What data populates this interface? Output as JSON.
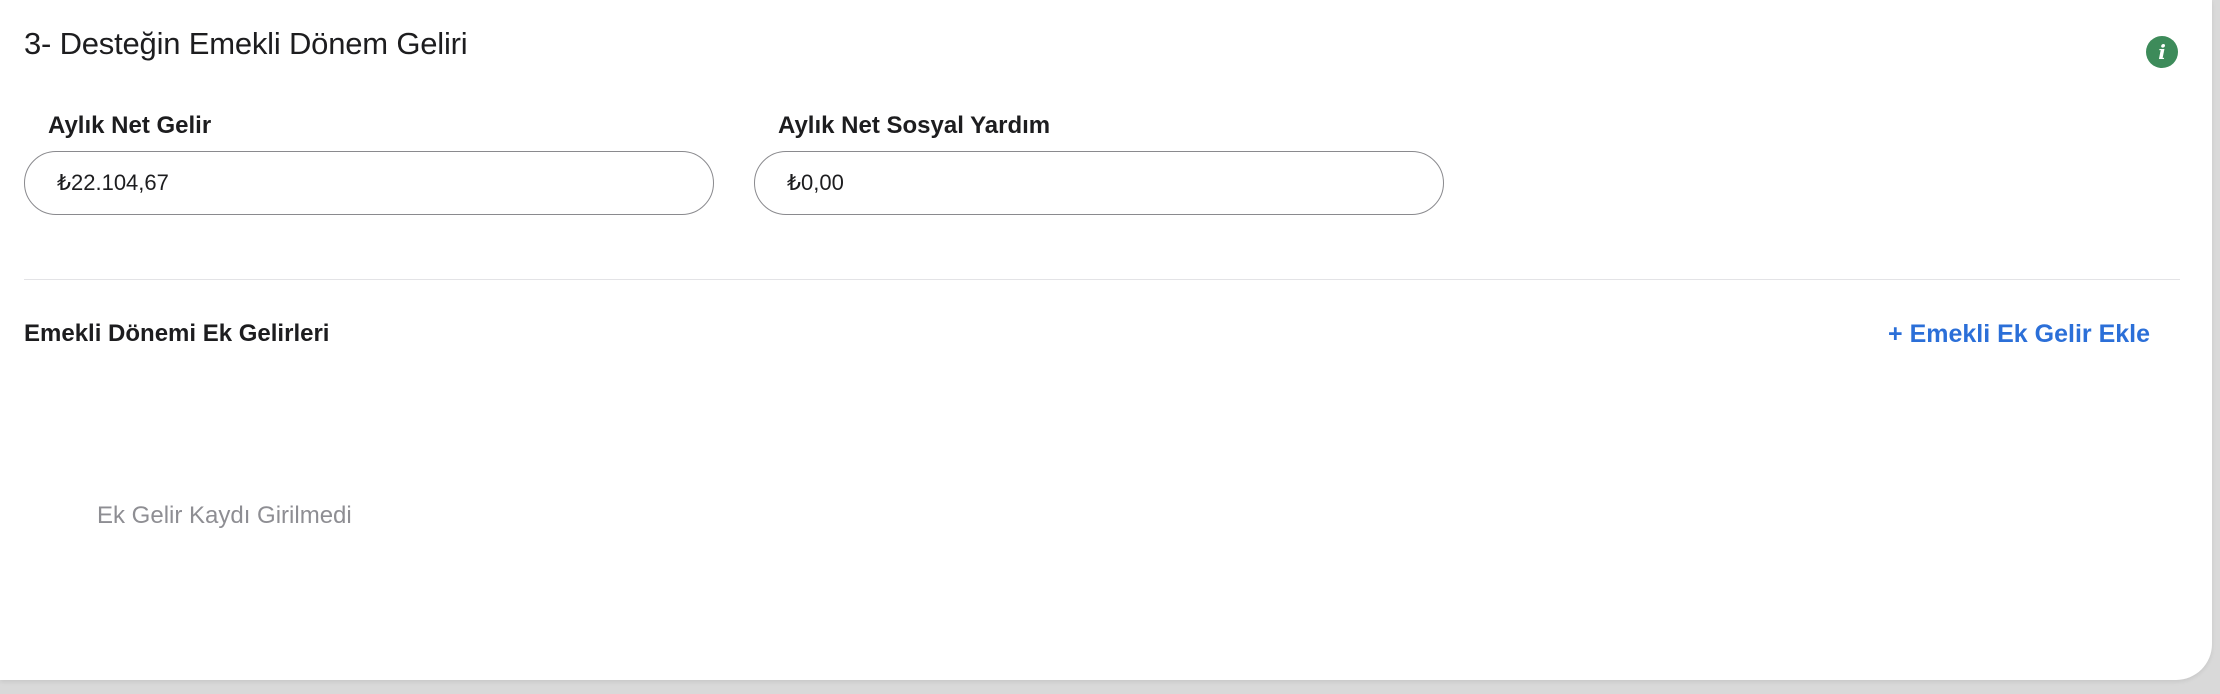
{
  "section": {
    "title": "3- Desteğin Emekli Dönem Geliri",
    "info_icon_glyph": "i",
    "info_icon": "info-icon"
  },
  "fields": {
    "monthly_net_income": {
      "label": "Aylık Net Gelir",
      "value": "₺22.104,67"
    },
    "monthly_net_social_aid": {
      "label": "Aylık Net Sosyal Yardım",
      "value": "₺0,00"
    }
  },
  "extra_income": {
    "title": "Emekli Dönemi Ek Gelirleri",
    "add_label": "+ Emekli Ek Gelir Ekle",
    "empty_text": "Ek Gelir Kaydı Girilmedi"
  },
  "colors": {
    "accent_link": "#2b6fd8",
    "info_icon_bg": "#3d8b5a"
  }
}
